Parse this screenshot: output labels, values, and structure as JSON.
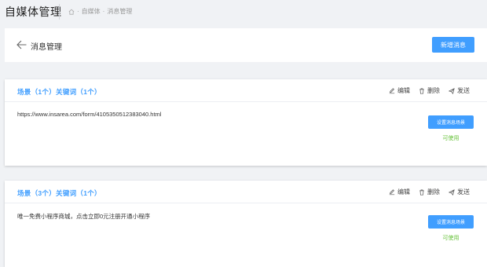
{
  "app": {
    "title": "自媒体管理"
  },
  "breadcrumb": {
    "sep1": "·",
    "item1": "自媒体",
    "sep2": "·",
    "item2": "消息管理"
  },
  "header": {
    "title": "消息管理",
    "new_button": "新增消息"
  },
  "actions": {
    "edit": "编辑",
    "delete": "删除",
    "send": "发送"
  },
  "messages": [
    {
      "label": "场景（1个）关键词（1个）",
      "content": "https://www.insarea.com/form/4105350512383040.html",
      "button": "设置消息场景",
      "status": "可使用"
    },
    {
      "label": "场景（3个）关键词（1个）",
      "content": "唯一免费小程序商城，点击立即0元注册开通小程序",
      "button": "设置消息场景",
      "status": "可使用"
    }
  ],
  "colors": {
    "accent": "#409eff",
    "status_ok": "#67c23a",
    "background": "#f0f2f5"
  },
  "icons": {
    "home": "home-icon",
    "back": "arrow-left-icon",
    "edit": "edit-icon",
    "delete": "trash-icon",
    "send": "send-icon"
  }
}
